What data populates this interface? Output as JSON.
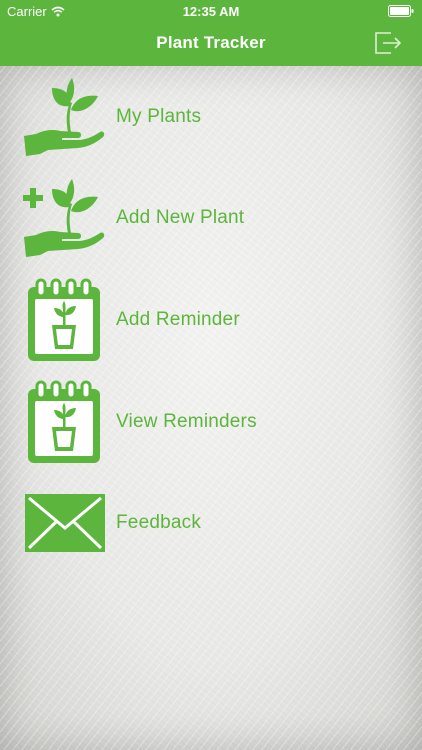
{
  "status_bar": {
    "carrier": "Carrier",
    "time": "12:35 AM"
  },
  "nav": {
    "title": "Plant Tracker",
    "logout_icon": "logout-icon"
  },
  "menu": {
    "items": [
      {
        "label": "My Plants",
        "icon": "hand-plant-icon"
      },
      {
        "label": "Add New Plant",
        "icon": "hand-plant-add-icon"
      },
      {
        "label": "Add Reminder",
        "icon": "calendar-plant-icon"
      },
      {
        "label": "View Reminders",
        "icon": "calendar-plant-icon"
      },
      {
        "label": "Feedback",
        "icon": "envelope-icon"
      }
    ]
  },
  "colors": {
    "accent": "#5cb53c",
    "background": "#e9e9e7"
  }
}
